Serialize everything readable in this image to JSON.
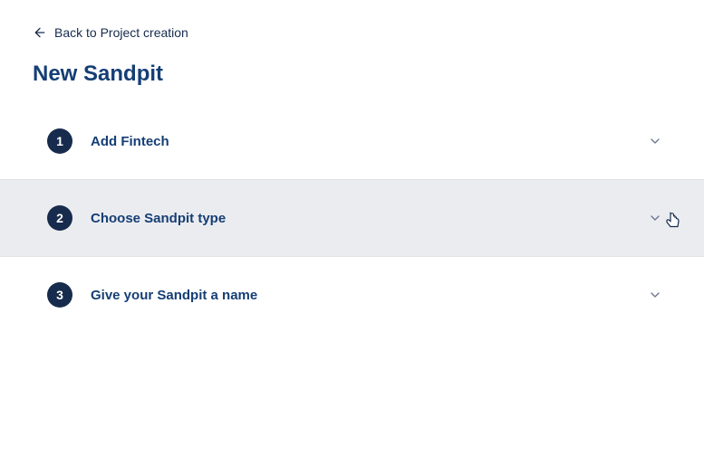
{
  "back": {
    "label": "Back to Project creation"
  },
  "title": "New Sandpit",
  "steps": [
    {
      "number": "1",
      "title": "Add Fintech"
    },
    {
      "number": "2",
      "title": "Choose Sandpit type"
    },
    {
      "number": "3",
      "title": "Give your Sandpit a name"
    }
  ]
}
